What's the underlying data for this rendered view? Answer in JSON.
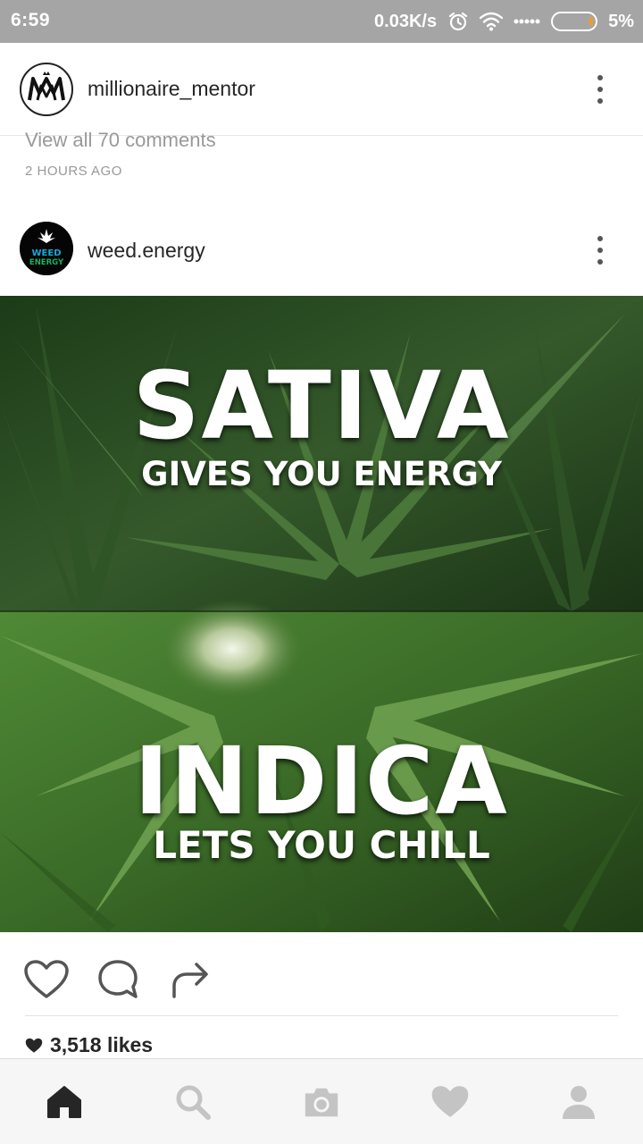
{
  "status_bar": {
    "time": "6:59",
    "network_speed": "0.03K/s",
    "battery_percent": "5%",
    "icons": [
      "alarm-icon",
      "wifi-icon",
      "signal-dots-icon",
      "battery-icon"
    ]
  },
  "post_previous": {
    "username": "millionaire_mentor",
    "avatar_text": "M",
    "view_comments": "View all 70 comments",
    "time_ago": "2 HOURS AGO"
  },
  "post": {
    "username": "weed.energy",
    "avatar_line1": "WEED",
    "avatar_line2": "ENERGY",
    "image_text": {
      "top_big": "SATIVA",
      "top_small": "GIVES YOU ENERGY",
      "bottom_big": "INDICA",
      "bottom_small": "LETS YOU CHILL"
    },
    "likes": "3,518 likes"
  },
  "bottom_nav": {
    "items": [
      "home-icon",
      "search-icon",
      "camera-icon",
      "heart-icon",
      "profile-icon"
    ],
    "active": "home-icon"
  },
  "colors": {
    "status_bar": "#a5a5a5",
    "text_primary": "#262626",
    "text_secondary": "#999999",
    "leaf_green": "#3e6b2a",
    "nav_inactive": "#c4c4c4",
    "nav_active": "#262626"
  }
}
